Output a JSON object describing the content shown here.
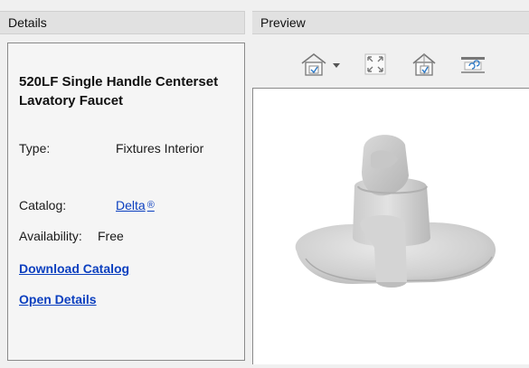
{
  "details": {
    "header": "Details",
    "title": "520LF Single Handle Centerset Lavatory Faucet",
    "type_label": "Type:",
    "type_value": "Fixtures Interior",
    "catalog_label": "Catalog:",
    "catalog_value": "Delta",
    "catalog_mark": "®",
    "availability_label": "Availability:",
    "availability_value": "Free",
    "download_link": "Download Catalog",
    "open_details_link": "Open Details"
  },
  "preview": {
    "header": "Preview",
    "toolbar": [
      {
        "name": "view-camera-icon"
      },
      {
        "name": "fit-view-icon"
      },
      {
        "name": "rotate-view-icon"
      },
      {
        "name": "refresh-view-icon"
      }
    ]
  }
}
